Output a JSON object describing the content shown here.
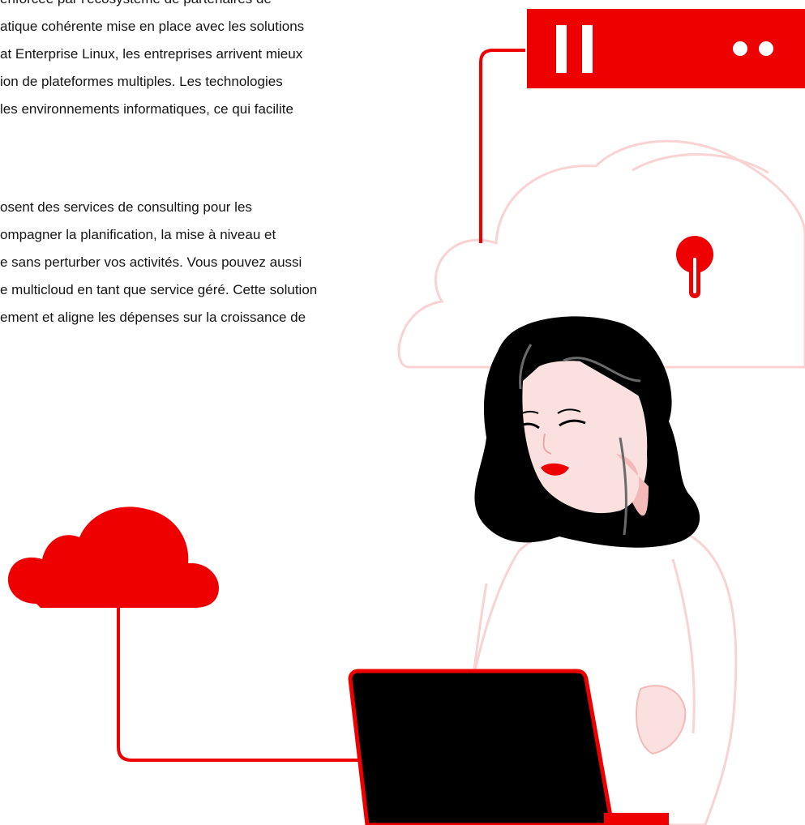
{
  "paragraphs": [
    {
      "lines": [
        "enforcée par l'écosystème de partenaires de",
        "atique cohérente mise en place avec les solutions",
        "at Enterprise Linux, les entreprises arrivent mieux",
        "ion de plateformes multiples. Les technologies",
        "les environnements informatiques, ce qui facilite"
      ]
    },
    {
      "lines": [
        "osent des services de consulting pour les",
        "ompagner la planification, la mise à niveau et",
        "e sans perturber vos activités. Vous pouvez aussi",
        "e multicloud en tant que service géré. Cette solution",
        "ement et aligne les dépenses sur la croissance de"
      ]
    }
  ],
  "illustration": {
    "colors": {
      "brand_red": "#ee0000",
      "outline_pink": "#f9d3d3",
      "skin": "#fbe0e0",
      "skin_shadow": "#f4b9b9",
      "hair": "#000000",
      "laptop": "#000000"
    },
    "icons": [
      "server-icon",
      "cloud-lock-icon",
      "keyhole-icon",
      "red-cloud-icon",
      "laptop-icon"
    ]
  }
}
